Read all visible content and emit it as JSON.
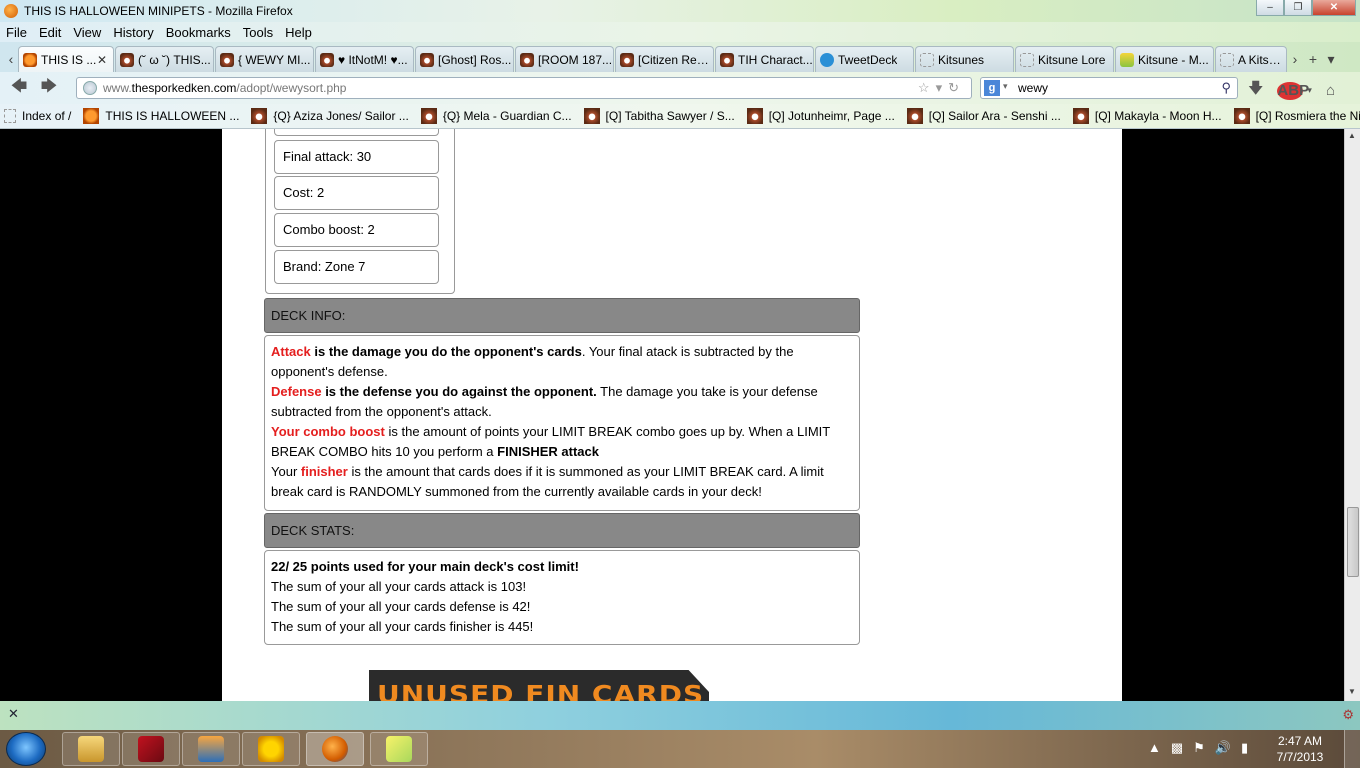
{
  "window": {
    "title": "THIS IS HALLOWEEN MINIPETS - Mozilla Firefox"
  },
  "menu": [
    "File",
    "Edit",
    "View",
    "History",
    "Bookmarks",
    "Tools",
    "Help"
  ],
  "tabs": [
    {
      "label": "THIS IS ...",
      "icon": "halloween-icon",
      "active": true
    },
    {
      "label": "(˘ ω ˘) THIS...",
      "icon": "minipet-icon"
    },
    {
      "label": "{ WEWY MI...",
      "icon": "minipet-icon"
    },
    {
      "label": "♥ ItNotM! ♥...",
      "icon": "minipet-icon"
    },
    {
      "label": "[Ghost] Ros...",
      "icon": "minipet-icon"
    },
    {
      "label": "[ROOM 187...",
      "icon": "minipet-icon"
    },
    {
      "label": "[Citizen Req...",
      "icon": "minipet-icon"
    },
    {
      "label": "TIH Charact...",
      "icon": "minipet-icon"
    },
    {
      "label": "TweetDeck",
      "icon": "twitter-icon"
    },
    {
      "label": "Kitsunes",
      "icon": "blank-page-icon"
    },
    {
      "label": "Kitsune Lore",
      "icon": "blank-page-icon"
    },
    {
      "label": "Kitsune - M...",
      "icon": "wiki-icon"
    },
    {
      "label": "A Kitsune",
      "icon": "blank-page-icon"
    }
  ],
  "nav": {
    "url_host_prefix": "www.",
    "url_domain": "thesporkedken.com",
    "url_path": "/adopt/wewysort.php",
    "search_query": "wewy",
    "abp_label": "ABP"
  },
  "bookmarks": [
    {
      "label": "Index of /",
      "icon": "blank-page-icon"
    },
    {
      "label": "THIS IS HALLOWEEN ...",
      "icon": "halloween-icon"
    },
    {
      "label": "{Q} Aziza Jones/ Sailor ...",
      "icon": "minipet-icon"
    },
    {
      "label": "{Q} Mela - Guardian C...",
      "icon": "minipet-icon"
    },
    {
      "label": "[Q] Tabitha Sawyer / S...",
      "icon": "minipet-icon"
    },
    {
      "label": "[Q] Jotunheimr, Page ...",
      "icon": "minipet-icon"
    },
    {
      "label": "[Q] Sailor Ara - Senshi ...",
      "icon": "minipet-icon"
    },
    {
      "label": "[Q] Makayla - Moon H...",
      "icon": "minipet-icon"
    },
    {
      "label": "[Q] Rosmiera the Nigh...",
      "icon": "minipet-icon"
    }
  ],
  "card_stats": [
    "Final attack: 30",
    "Cost: 2",
    "Combo boost: 2",
    "Brand: Zone 7"
  ],
  "deck_info": {
    "heading": "DECK INFO:",
    "attack_term": "Attack",
    "attack_bold": " is the damage you do the opponent's cards",
    "attack_rest": ". Your final atack is subtracted by the opponent's defense.",
    "defense_term": "Defense",
    "defense_bold": " is the defense you do against the opponent.",
    "defense_rest": " The damage you take is your defense subtracted from the opponent's attack.",
    "combo_term": "Your combo boost",
    "combo_rest": " is the amount of points your LIMIT BREAK combo goes up by. When a LIMIT BREAK COMBO hits 10 you perform a ",
    "combo_finisher": "FINISHER attack",
    "finisher_lead": "Your ",
    "finisher_term": "finisher",
    "finisher_rest": " is the amount that cards does if it is summoned as your LIMIT BREAK card. A limit break card is RANDOMLY summoned from the currently available cards in your deck!"
  },
  "deck_stats": {
    "heading": "DECK STATS:",
    "cost_line": "22/ 25 points used for your main deck's cost limit!",
    "attack_line": "The sum of your all your cards attack is 103!",
    "defense_line": "The sum of your all your cards defense is 42!",
    "finisher_line": "The sum of your all your cards finisher is 445!"
  },
  "banner": {
    "text": "UNUSED FIN CARDS"
  },
  "taskbar": {
    "apps": [
      "folder-icon",
      "kaspersky-icon",
      "media-player-icon",
      "aim-icon",
      "firefox-icon",
      "sticky-notes-icon"
    ],
    "time": "2:47 AM",
    "date": "7/7/2013"
  }
}
